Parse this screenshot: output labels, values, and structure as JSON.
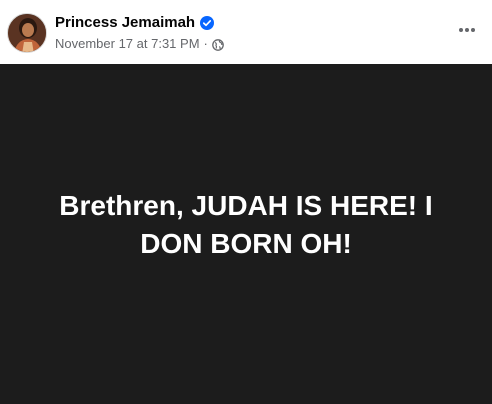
{
  "post": {
    "author": "Princess Jemaimah",
    "verified": true,
    "timestamp": "November 17 at 7:31 PM",
    "separator": "·",
    "audience_icon": "globe-icon",
    "more_icon": "more-options-icon",
    "text": "Brethren, JUDAH IS HERE! I DON BORN OH!"
  },
  "colors": {
    "content_background": "#1c1c1c",
    "verified_badge": "#0866ff",
    "secondary_text": "#65676b"
  }
}
